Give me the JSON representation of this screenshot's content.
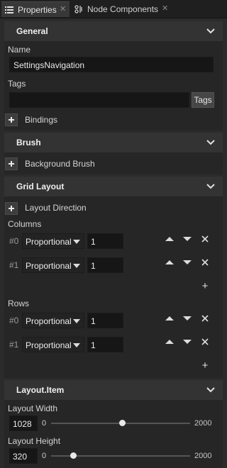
{
  "tabs": [
    {
      "label": "Properties",
      "icon": "list-icon",
      "close": "✕"
    },
    {
      "label": "Node Components",
      "icon": "component-icon",
      "close": "✕"
    }
  ],
  "general": {
    "header": "General",
    "name_label": "Name",
    "name_value": "SettingsNavigation",
    "tags_label": "Tags",
    "tags_value": "",
    "tags_button": "Tags",
    "bindings_label": "Bindings"
  },
  "brush": {
    "header": "Brush",
    "background_brush_label": "Background Brush"
  },
  "grid_layout": {
    "header": "Grid Layout",
    "layout_direction_label": "Layout Direction",
    "columns_label": "Columns",
    "columns": [
      {
        "index": "#0",
        "type": "Proportional",
        "value": "1"
      },
      {
        "index": "#1",
        "type": "Proportional",
        "value": "1"
      }
    ],
    "rows_label": "Rows",
    "rows": [
      {
        "index": "#0",
        "type": "Proportional",
        "value": "1"
      },
      {
        "index": "#1",
        "type": "Proportional",
        "value": "1"
      }
    ],
    "add_symbol": "+"
  },
  "layout_item": {
    "header": "Layout.Item",
    "width": {
      "label": "Layout Width",
      "value": "1028",
      "min": "0",
      "max": "2000",
      "fraction": 0.514
    },
    "height": {
      "label": "Layout Height",
      "value": "320",
      "min": "0",
      "max": "2000",
      "fraction": 0.16
    }
  },
  "colors": {
    "background": "#2b2b2b",
    "header": "#333333",
    "field": "#161616"
  }
}
